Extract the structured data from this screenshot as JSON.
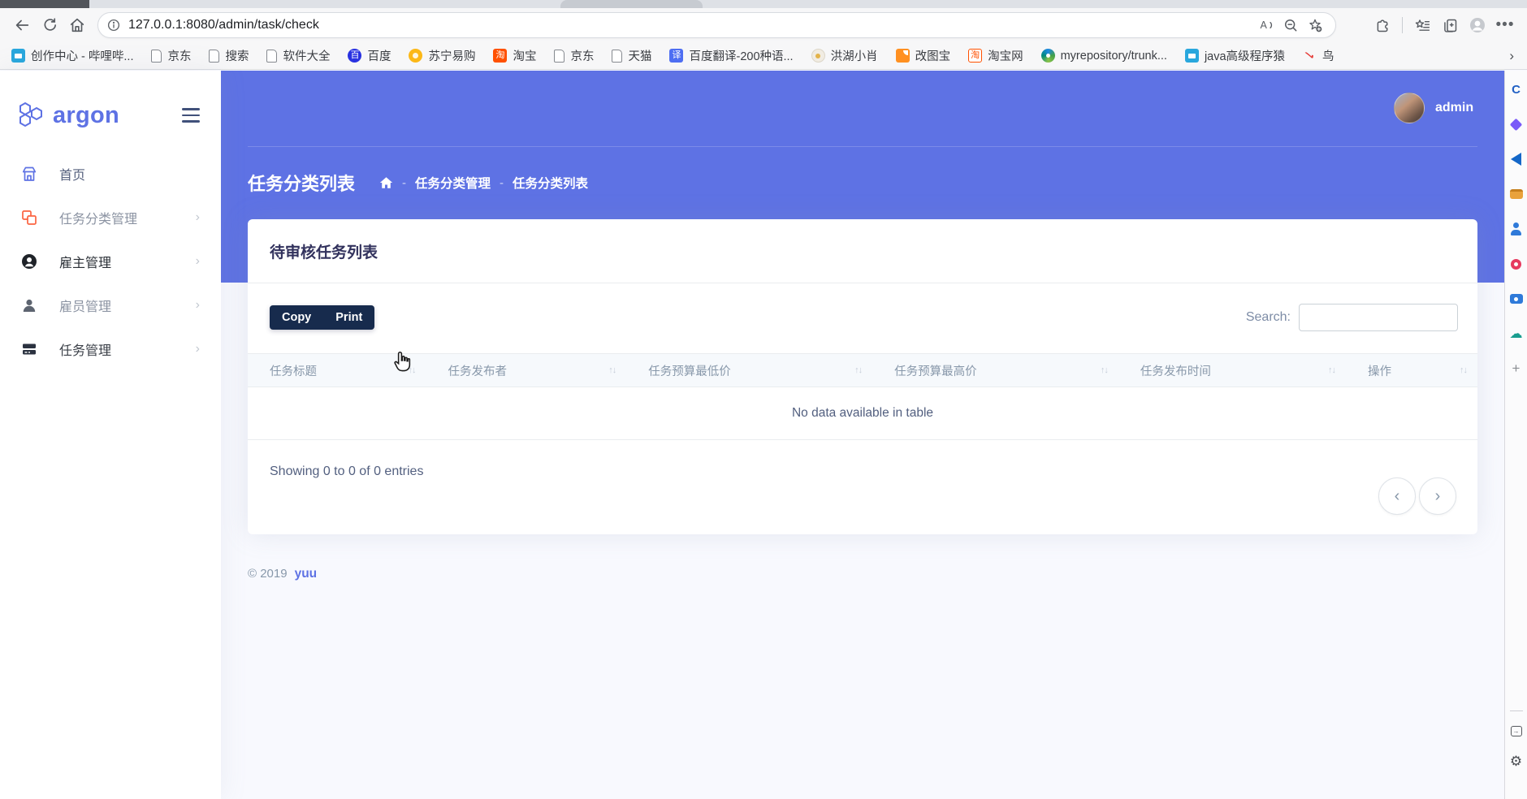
{
  "browser": {
    "toolbar": {
      "url": "127.0.0.1:8080/admin/task/check"
    },
    "bookmarks": [
      {
        "label": "创作中心 - 哔哩哔...",
        "icon": "bilibili-tv"
      },
      {
        "label": "京东",
        "icon": "page"
      },
      {
        "label": "搜索",
        "icon": "page"
      },
      {
        "label": "软件大全",
        "icon": "page"
      },
      {
        "label": "百度",
        "icon": "baidu-paw"
      },
      {
        "label": "苏宁易购",
        "icon": "suning-lion"
      },
      {
        "label": "淘宝",
        "icon": "taobao"
      },
      {
        "label": "京东",
        "icon": "page"
      },
      {
        "label": "天猫",
        "icon": "page"
      },
      {
        "label": "百度翻译-200种语...",
        "icon": "baidu-translate"
      },
      {
        "label": "洪湖小肖",
        "icon": "misc-avatar"
      },
      {
        "label": "改图宝",
        "icon": "gaitubao"
      },
      {
        "label": "淘宝网",
        "icon": "taobao-outline"
      },
      {
        "label": "myrepository/trunk...",
        "icon": "repo-swirl"
      },
      {
        "label": "java高级程序猿",
        "icon": "bilibili-tv"
      },
      {
        "label": "鸟",
        "icon": "red-bird"
      }
    ],
    "bookmarks_overflow": "›"
  },
  "app": {
    "sidebar": {
      "logo_text": "argon",
      "items": [
        {
          "label": "首页",
          "icon": "shop",
          "has_children": false
        },
        {
          "label": "任务分类管理",
          "icon": "category-squares",
          "has_children": true
        },
        {
          "label": "雇主管理",
          "icon": "employer-circle",
          "has_children": true
        },
        {
          "label": "雇员管理",
          "icon": "employee-person",
          "has_children": true
        },
        {
          "label": "任务管理",
          "icon": "task-cards",
          "has_children": true
        }
      ]
    },
    "navbar": {
      "username": "admin"
    },
    "page_header": {
      "title": "任务分类列表",
      "separator": "-",
      "breadcrumb": [
        {
          "label": "任务分类管理"
        },
        {
          "label": "任务分类列表"
        }
      ]
    },
    "card": {
      "title": "待审核任务列表",
      "buttons": {
        "copy": "Copy",
        "print": "Print"
      },
      "search_label": "Search:",
      "table": {
        "columns": [
          "任务标题",
          "任务发布者",
          "任务预算最低价",
          "任务预算最高价",
          "任务发布时间",
          "操作"
        ],
        "sort_icon": "↑↓",
        "empty_text": "No data available in table"
      },
      "info_text": "Showing 0 to 0 of 0 entries",
      "pagination": {
        "prev": "‹",
        "next": "›"
      }
    },
    "footer": {
      "copyright": "© 2019",
      "brand": "yuu"
    },
    "colors": {
      "primary": "#5e72e4",
      "button_dark": "#172b4d",
      "table_header_text": "#8898aa",
      "orange_icon": "#fb6340"
    }
  }
}
